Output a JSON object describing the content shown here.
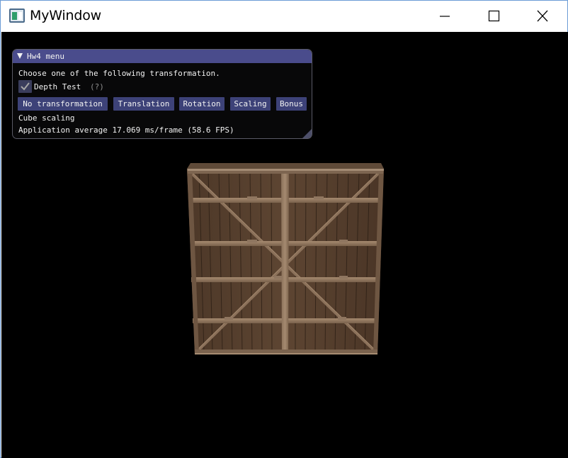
{
  "window": {
    "title": "MyWindow",
    "controls": [
      "minimize-icon",
      "maximize-icon",
      "close-icon"
    ]
  },
  "imgui": {
    "title": "Hw4 menu",
    "instructions": "Choose one of the following transformation.",
    "checkbox": {
      "label": "Depth Test",
      "checked": true,
      "help": "(?)"
    },
    "buttons": [
      "No transformation",
      "Translation",
      "Rotation",
      "Scaling",
      "Bonus"
    ],
    "mode_text": "Cube scaling",
    "fps_text": "Application average 17.069 ms/frame (58.6 FPS)"
  },
  "scene": {
    "object": "wooden-crate",
    "colors": {
      "background": "#000000",
      "wood_dark": "#4a3526",
      "wood_mid": "#6e5440",
      "wood_light": "#9a8069"
    }
  }
}
